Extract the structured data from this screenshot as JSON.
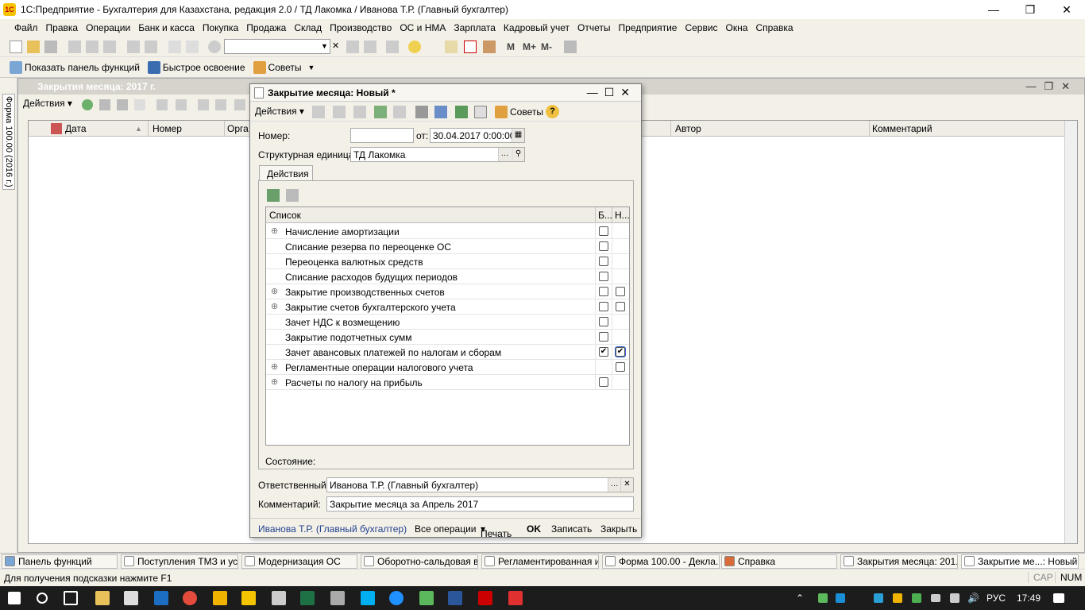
{
  "app": {
    "title": "1С:Предприятие - Бухгалтерия для Казахстана, редакция 2.0 / ТД Лакомка / Иванова Т.Р. (Главный бухгалтер)",
    "logo_text": "1С"
  },
  "menu": [
    "Файл",
    "Правка",
    "Операции",
    "Банк и касса",
    "Покупка",
    "Продажа",
    "Склад",
    "Производство",
    "ОС и НМА",
    "Зарплата",
    "Кадровый учет",
    "Отчеты",
    "Предприятие",
    "Сервис",
    "Окна",
    "Справка"
  ],
  "toolbar": {
    "m1": "M",
    "m2": "M+",
    "m3": "M-"
  },
  "toolbar2": {
    "show_panel": "Показать панель функций",
    "quick_learn": "Быстрое освоение",
    "tips": "Советы"
  },
  "left_panel": {
    "vertical_tab": "Форма 100.00 (2016 г.)"
  },
  "bg_window": {
    "title": "Закрытия месяца: 2017 г.",
    "actions": "Действия",
    "columns": {
      "date": "Дата",
      "number": "Номер",
      "org": "Орга",
      "author": "Автор",
      "comment": "Комментарий"
    }
  },
  "dialog": {
    "title": "Закрытие месяца: Новый *",
    "toolbar": {
      "actions": "Действия",
      "tips": "Советы",
      "help": "?"
    },
    "number_label": "Номер:",
    "number_value": "",
    "from_label": "от:",
    "date_value": "30.04.2017  0:00:00",
    "unit_label": "Структурная единица:",
    "unit_value": "ТД Лакомка",
    "tab": "Действия",
    "list_header": {
      "name": "Список",
      "col_b": "Б...",
      "col_n": "Н..."
    },
    "rows": [
      {
        "name": "Начисление амортизации",
        "expand": "⊕",
        "b": "☐",
        "n": ""
      },
      {
        "name": "Списание резерва по переоценке ОС",
        "expand": "",
        "b": "☐",
        "n": ""
      },
      {
        "name": "Переоценка валютных средств",
        "expand": "",
        "b": "☐",
        "n": ""
      },
      {
        "name": "Списание расходов будущих периодов",
        "expand": "",
        "b": "☐",
        "n": ""
      },
      {
        "name": "Закрытие производственных счетов",
        "expand": "⊕",
        "b": "☐",
        "n": "☐"
      },
      {
        "name": "Закрытие счетов бухгалтерского учета",
        "expand": "⊕",
        "b": "☐",
        "n": "☐"
      },
      {
        "name": "Зачет НДС к возмещению",
        "expand": "",
        "b": "☐",
        "n": ""
      },
      {
        "name": "Закрытие подотчетных сумм",
        "expand": "",
        "b": "☐",
        "n": ""
      },
      {
        "name": "Зачет авансовых платежей по налогам и сборам",
        "expand": "",
        "b": "✔",
        "n": "✔"
      },
      {
        "name": "Регламентные операции налогового учета",
        "expand": "⊕",
        "b": "",
        "n": "☐"
      },
      {
        "name": "Расчеты по налогу на прибыль",
        "expand": "⊕",
        "b": "☐",
        "n": ""
      }
    ],
    "state_label": "Состояние:",
    "responsible_label": "Ответственный:",
    "responsible_value": "Иванова Т.Р. (Главный бухгалтер)",
    "comment_label": "Комментарий:",
    "comment_value": "Закрытие месяца за Апрель 2017",
    "footer": {
      "user": "Иванова Т.Р. (Главный бухгалтер)",
      "all_ops": "Все операции",
      "print": "Печать",
      "ok": "OK",
      "save": "Записать",
      "close": "Закрыть"
    }
  },
  "tasks": [
    "Панель функций",
    "Поступления ТМЗ и ус...",
    "Модернизация ОС",
    "Оборотно-сальдовая в...",
    "Регламентированная и...",
    "Форма 100.00 - Декла...",
    "Справка",
    "Закрытия месяца: 201...",
    "Закрытие ме...: Новый *"
  ],
  "status": {
    "hint": "Для получения подсказки нажмите F1",
    "cap": "CAP",
    "num": "NUM"
  },
  "windows_taskbar": {
    "lang": "РУС",
    "time": "17:49"
  }
}
